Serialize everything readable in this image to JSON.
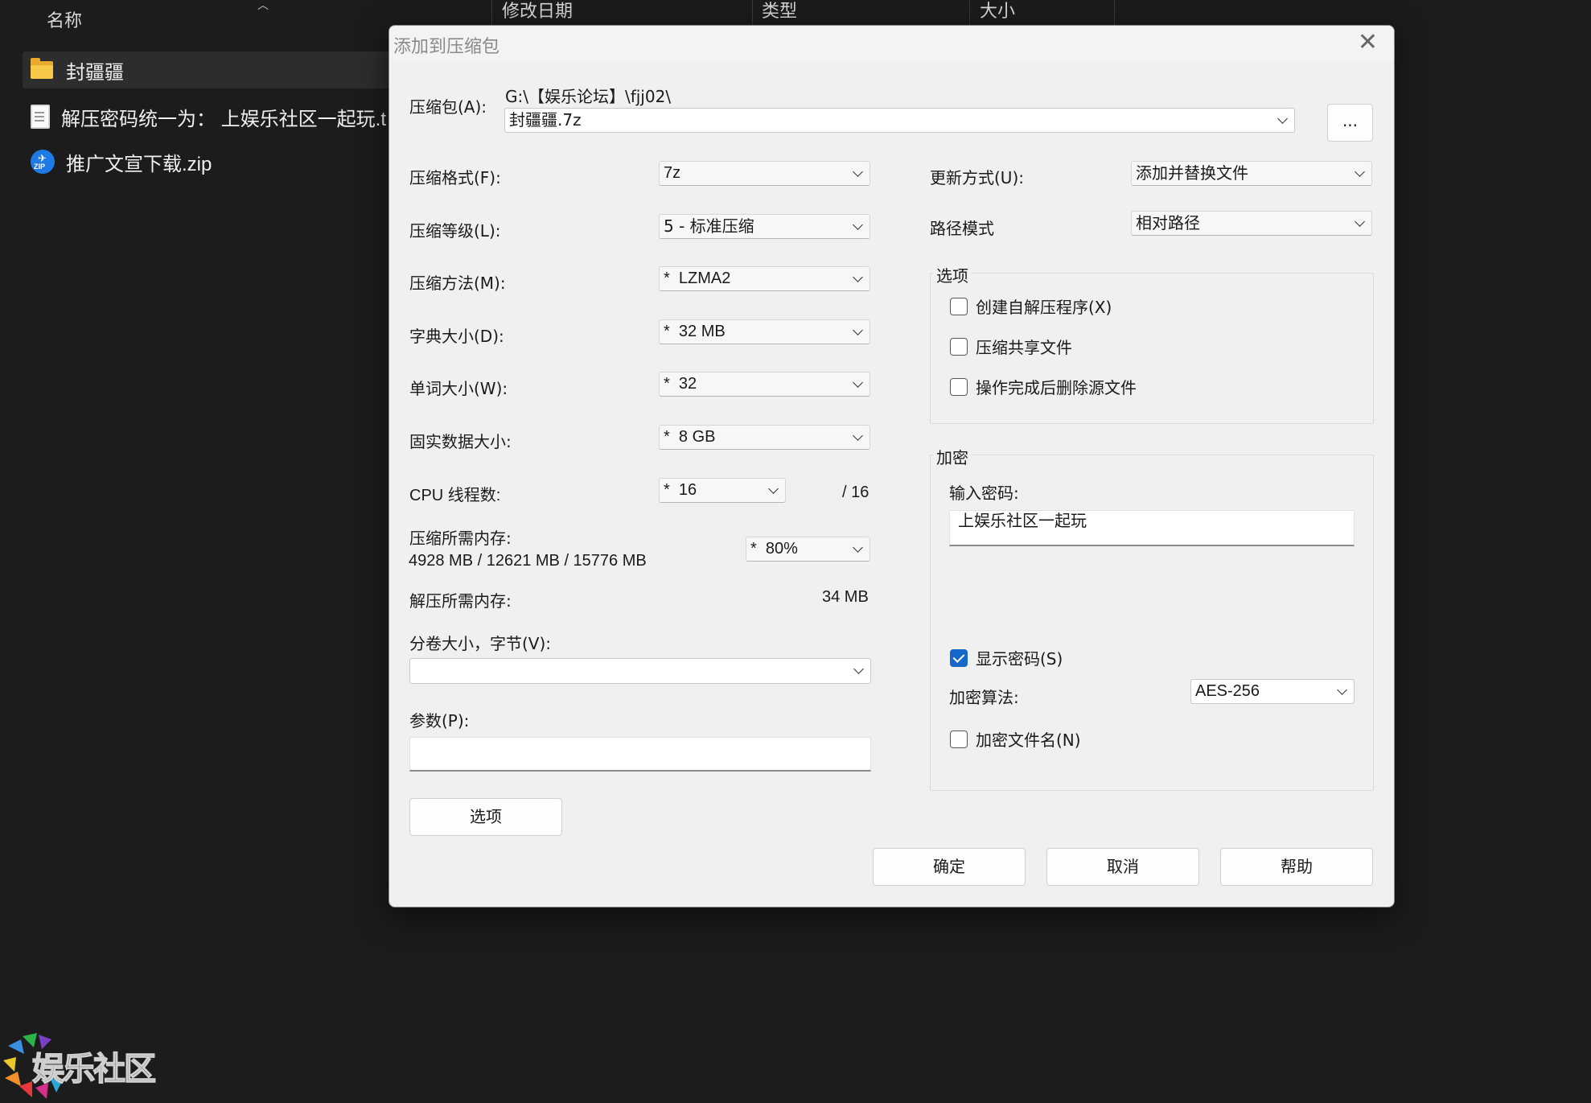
{
  "explorer": {
    "columns": {
      "name": "名称",
      "modified": "修改日期",
      "type": "类型",
      "size": "大小"
    },
    "files": [
      {
        "name": "封疆疆",
        "icon": "folder-icon"
      },
      {
        "name": "解压密码统一为： 上娱乐社区一起玩.t",
        "icon": "text-file-icon"
      },
      {
        "name": "推广文宣下载.zip",
        "icon": "zip-file-icon"
      }
    ]
  },
  "dialog": {
    "title": "添加到压缩包",
    "archive_label": "压缩包(A):",
    "archive_path": "G:\\【娱乐论坛】\\fjj02\\",
    "archive_name": "封疆疆.7z",
    "browse_label": "...",
    "format_label": "压缩格式(F):",
    "format_value": "7z",
    "level_label": "压缩等级(L):",
    "level_value": "5 - 标准压缩",
    "method_label": "压缩方法(M):",
    "method_value": "*  LZMA2",
    "dict_label": "字典大小(D):",
    "dict_value": "*  32 MB",
    "word_label": "单词大小(W):",
    "word_value": "*  32",
    "solid_label": "固实数据大小:",
    "solid_value": "*  8 GB",
    "cpu_label": "CPU 线程数:",
    "cpu_value": "*  16",
    "cpu_max": "/ 16",
    "mem_comp_label": "压缩所需内存:",
    "mem_comp_value": "4928 MB / 12621 MB / 15776 MB",
    "mem_percent": "*  80%",
    "mem_decomp_label": "解压所需内存:",
    "mem_decomp_value": "34 MB",
    "split_label": "分卷大小，字节(V):",
    "split_value": "",
    "params_label": "参数(P):",
    "params_value": "",
    "options_button": "选项",
    "update_label": "更新方式(U):",
    "update_value": "添加并替换文件",
    "path_label": "路径模式",
    "path_value": "相对路径",
    "options_group": {
      "title": "选项",
      "sfx": "创建自解压程序(X)",
      "shared": "压缩共享文件",
      "delete": "操作完成后删除源文件"
    },
    "encrypt_group": {
      "title": "加密",
      "password_label": "输入密码:",
      "password_value": "上娱乐社区一起玩",
      "show_password": "显示密码(S)",
      "method_label": "加密算法:",
      "method_value": "AES-256",
      "encrypt_names": "加密文件名(N)"
    },
    "ok": "确定",
    "cancel": "取消",
    "help": "帮助"
  },
  "watermark": {
    "text": "娱乐社区"
  }
}
